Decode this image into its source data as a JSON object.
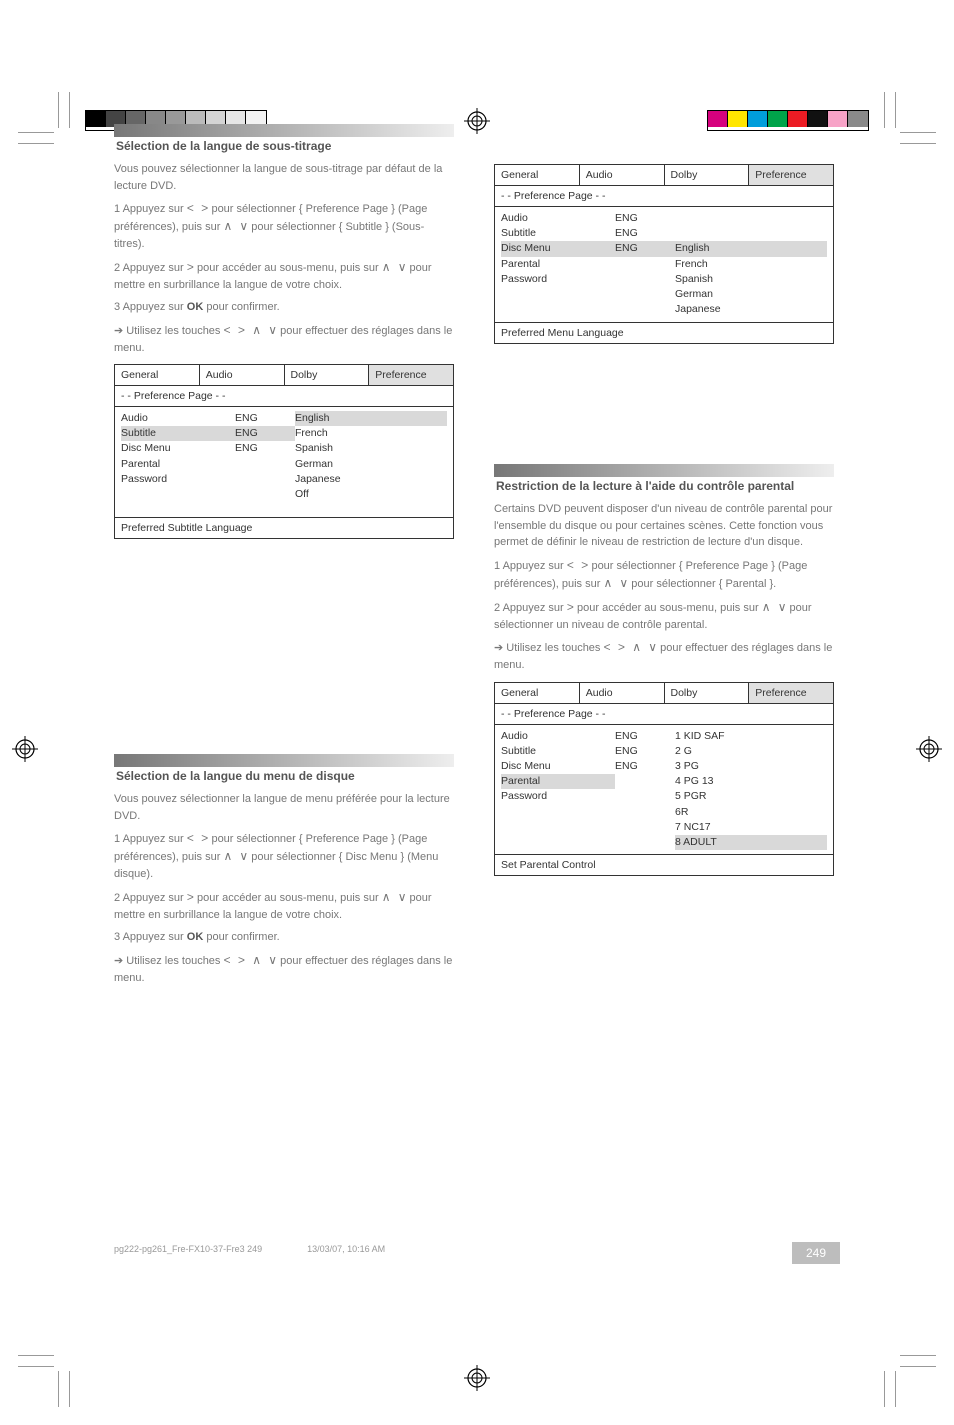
{
  "page_number": "249",
  "job_ref": "pg222-pg261_Fre-FX10-37-Fre3     249",
  "job_ts": "13/03/07, 10:16 AM",
  "sections": {
    "subtitle": {
      "title": "Sélection de la langue de sous-titrage",
      "desc": "Vous pouvez sélectionner la langue de sous-titrage par défaut de la lecture DVD.",
      "step1a": "1  Appuyez sur ",
      "step1b": " pour sélectionner { Preference Page } (Page préférences), puis sur ",
      "step1c": " pour sélectionner { Subtitle } (Sous-titres).",
      "step2a": "2  Appuyez sur ",
      "step2b": " pour accéder au sous-menu, puis sur ",
      "step2c": " pour mettre en surbrillance la langue de votre choix.",
      "step3a": "3  Appuyez sur ",
      "step3b": "OK",
      "step3c": " pour confirmer.",
      "note": "➔   Utilisez les touches ",
      "note2": " pour effectuer des réglages dans le menu."
    },
    "discmenu": {
      "title": "Sélection de la langue du menu de disque",
      "desc": "Vous pouvez sélectionner la langue de menu préférée pour la lecture DVD.",
      "step1a": "1  Appuyez sur ",
      "step1b": " pour sélectionner { Preference Page } (Page préférences), puis sur ",
      "step1c": " pour sélectionner { Disc Menu } (Menu disque).",
      "step2a": "2  Appuyez sur ",
      "step2b": " pour accéder au sous-menu, puis sur ",
      "step2c": " pour mettre en surbrillance la langue de votre choix.",
      "step3a": "3  Appuyez sur ",
      "step3b": "OK",
      "step3c": " pour confirmer.",
      "note": "➔   Utilisez les touches ",
      "note2": " pour effectuer des réglages dans le menu."
    },
    "parental": {
      "title": "Restriction de la lecture à l'aide du contrôle parental",
      "desc": "Certains DVD peuvent disposer d'un niveau de contrôle parental pour l'ensemble du disque ou pour certaines scènes. Cette fonction vous permet de définir le niveau de restriction de lecture d'un disque.",
      "step1a": "1  Appuyez sur ",
      "step1b": " pour sélectionner { Preference Page } (Page préférences), puis sur ",
      "step1c": " pour sélectionner { Parental }.",
      "step2a": "2  Appuyez sur ",
      "step2b": " pour accéder au sous-menu, puis sur ",
      "step2c": " pour sélectionner un niveau de contrôle parental.",
      "note": "➔   Utilisez les touches ",
      "note2": " pour effectuer des réglages dans le menu."
    }
  },
  "nav_lr": "<   >",
  "nav_ud": "∧   ∨",
  "nav_r": ">",
  "nav_all": "<   >   ∧   ∨",
  "menu_tabs": {
    "general": "General",
    "audio": "Audio",
    "dolby": "Dolby",
    "preference": "Preference"
  },
  "menu_title": "- -  Preference  Page   - -",
  "menu_left_labels": {
    "audio": "Audio",
    "subtitle": "Subtitle",
    "discmenu": "Disc Menu",
    "parental": "Parental",
    "password": "Password"
  },
  "menu_mid": {
    "eng": "ENG"
  },
  "subtitle_options": [
    "English",
    "French",
    "Spanish",
    "German",
    "Japanese",
    "Off"
  ],
  "discmenu_options": [
    "English",
    "French",
    "Spanish",
    "German",
    "Japanese"
  ],
  "parental_options": [
    "1 KID SAF",
    "2 G",
    "3 PG",
    "4 PG 13",
    "5 PGR",
    "6R",
    "7 NC17",
    "8 ADULT"
  ],
  "footers": {
    "subtitle": "Preferred Subtitle Language",
    "discmenu": "Preferred Menu Language",
    "parental": "Set Parental Control"
  }
}
